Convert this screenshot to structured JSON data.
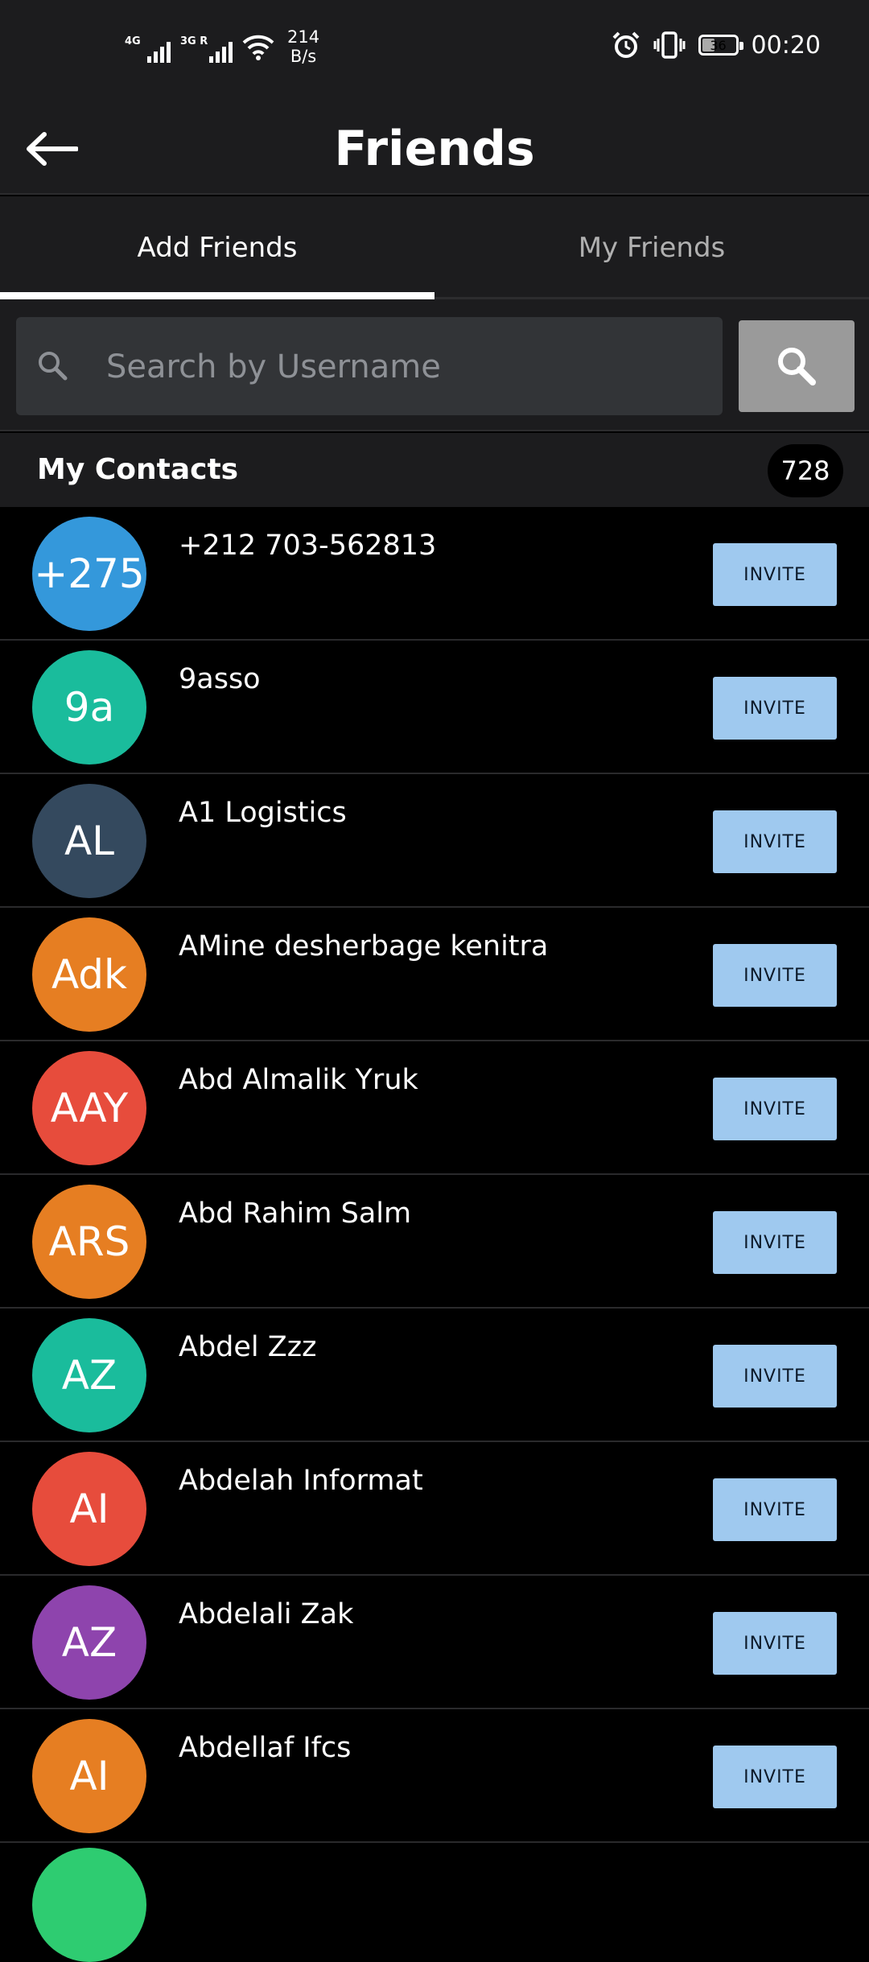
{
  "status_bar": {
    "network_1": "4G",
    "network_2": "3G R",
    "speed_value": "214",
    "speed_unit": "B/s",
    "battery": "36",
    "time": "00:20"
  },
  "header": {
    "title": "Friends"
  },
  "tabs": [
    {
      "label": "Add Friends"
    },
    {
      "label": "My Friends"
    }
  ],
  "search": {
    "placeholder": "Search by Username",
    "value": ""
  },
  "contacts": {
    "title": "My Contacts",
    "count": "728",
    "invite_label": "INVITE",
    "items": [
      {
        "initials": "+275",
        "name": "+212 703-562813",
        "color": "#3498db"
      },
      {
        "initials": "9a",
        "name": "9asso",
        "color": "#1abc9c"
      },
      {
        "initials": "AL",
        "name": "A1 Logistics",
        "color": "#34495e"
      },
      {
        "initials": "Adk",
        "name": "AMine desherbage kenitra",
        "color": "#e67e22"
      },
      {
        "initials": "AAY",
        "name": "Abd Almalik Yruk",
        "color": "#e74c3c"
      },
      {
        "initials": "ARS",
        "name": "Abd Rahim Salm",
        "color": "#e67e22"
      },
      {
        "initials": "AZ",
        "name": "Abdel Zzz",
        "color": "#1abc9c"
      },
      {
        "initials": "AI",
        "name": "Abdelah Informat",
        "color": "#e74c3c"
      },
      {
        "initials": "AZ",
        "name": "Abdelali Zak",
        "color": "#8e44ad"
      },
      {
        "initials": "AI",
        "name": "Abdellaf Ifcs",
        "color": "#e67e22"
      }
    ]
  }
}
